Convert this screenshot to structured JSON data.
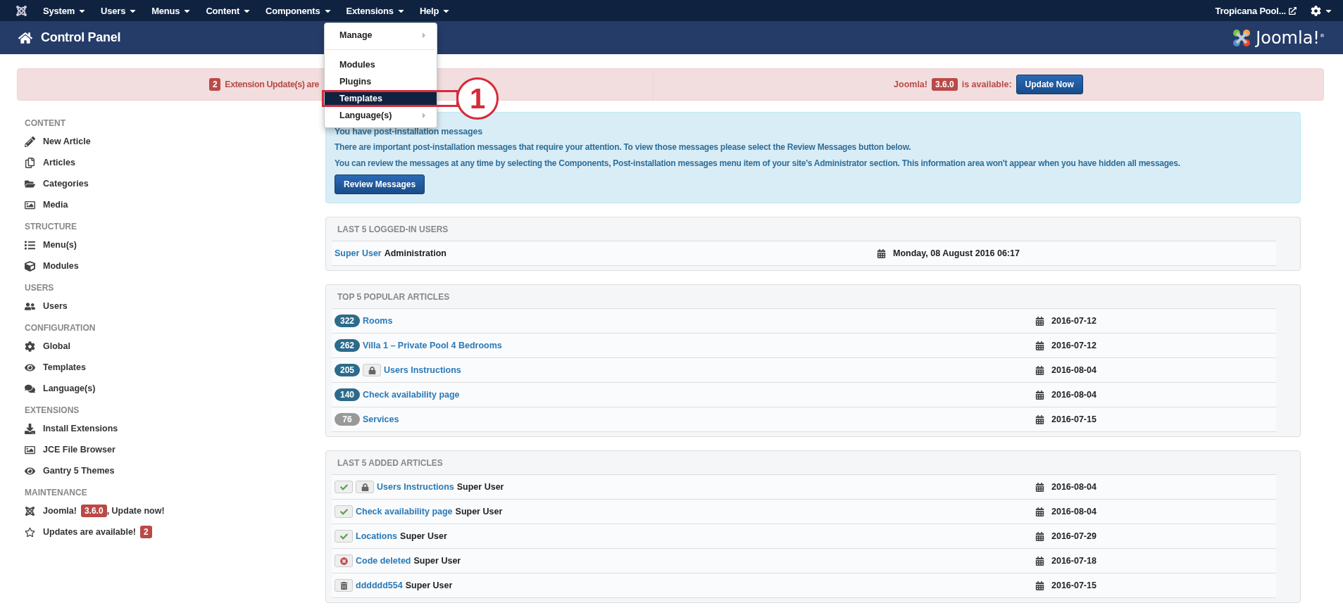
{
  "navbar": {
    "menus": [
      {
        "label": "System"
      },
      {
        "label": "Users"
      },
      {
        "label": "Menus"
      },
      {
        "label": "Content"
      },
      {
        "label": "Components"
      },
      {
        "label": "Extensions"
      },
      {
        "label": "Help"
      }
    ],
    "site_link": "Tropicana Pool..."
  },
  "header": {
    "title": "Control Panel",
    "logo_text": "Joomla!",
    "logo_mark": "®"
  },
  "dropdown": {
    "items": [
      {
        "kind": "submenu",
        "label": "Manage",
        "selected": false
      },
      {
        "kind": "divider"
      },
      {
        "kind": "item",
        "label": "Modules",
        "selected": false
      },
      {
        "kind": "item",
        "label": "Plugins",
        "selected": false
      },
      {
        "kind": "item",
        "label": "Templates",
        "selected": true
      },
      {
        "kind": "submenu",
        "label": "Language(s)",
        "selected": false
      }
    ]
  },
  "callout": {
    "number": "1"
  },
  "alerts": [
    {
      "badge": "2",
      "text": "Extension Update(s) are"
    },
    {
      "before": "Joomla!",
      "badge": "3.6.0",
      "after": "is available:",
      "button": "Update Now"
    }
  ],
  "sidebar": [
    {
      "heading": "CONTENT",
      "items": [
        {
          "label": "New Article"
        },
        {
          "label": "Articles"
        },
        {
          "label": "Categories"
        },
        {
          "label": "Media"
        }
      ]
    },
    {
      "heading": "STRUCTURE",
      "items": [
        {
          "label": "Menu(s)"
        },
        {
          "label": "Modules"
        }
      ]
    },
    {
      "heading": "USERS",
      "items": [
        {
          "label": "Users"
        }
      ]
    },
    {
      "heading": "CONFIGURATION",
      "items": [
        {
          "label": "Global"
        },
        {
          "label": "Templates"
        },
        {
          "label": "Language(s)"
        }
      ]
    },
    {
      "heading": "EXTENSIONS",
      "items": [
        {
          "label": "Install Extensions"
        },
        {
          "label": "JCE File Browser"
        },
        {
          "label": "Gantry 5 Themes"
        }
      ]
    },
    {
      "heading": "MAINTENANCE",
      "items": [
        {
          "label": "Joomla!",
          "badge": "3.6.0",
          "after": ", Update now!"
        },
        {
          "label": "Updates are available!",
          "badge": "2"
        }
      ]
    }
  ],
  "info": {
    "heading": "You have post-installation messages",
    "paragraphs": [
      "There are important post-installation messages that require your attention. To view those messages please select the Review Messages button below.",
      "You can review the messages at any time by selecting the Components, Post-installation messages menu item of your site's Administrator section. This information area won't appear when you have hidden all messages."
    ],
    "button": "Review Messages"
  },
  "logged_users": {
    "title": "LAST 5 LOGGED-IN USERS",
    "rows": [
      {
        "user": "Super User",
        "area": "Administration",
        "date": "Monday, 08 August 2016 06:17"
      }
    ]
  },
  "popular_articles": {
    "title": "TOP 5 POPULAR ARTICLES",
    "rows": [
      {
        "hits": "322",
        "hot": true,
        "locked": false,
        "title": "Rooms",
        "date": "2016-07-12"
      },
      {
        "hits": "262",
        "hot": true,
        "locked": false,
        "title": "Villa 1 – Private Pool 4 Bedrooms",
        "date": "2016-07-12"
      },
      {
        "hits": "205",
        "hot": true,
        "locked": true,
        "title": "Users Instructions",
        "date": "2016-08-04"
      },
      {
        "hits": "140",
        "hot": true,
        "locked": false,
        "title": "Check availability page",
        "date": "2016-08-04"
      },
      {
        "hits": "76",
        "hot": false,
        "locked": false,
        "title": "Services",
        "date": "2016-07-15"
      }
    ]
  },
  "added_articles": {
    "title": "LAST 5 ADDED ARTICLES",
    "rows": [
      {
        "kind": "published",
        "locked": true,
        "title": "Users Instructions",
        "author": "Super User",
        "date": "2016-08-04"
      },
      {
        "kind": "published",
        "locked": false,
        "title": "Check availability page",
        "author": "Super User",
        "date": "2016-08-04"
      },
      {
        "kind": "published",
        "locked": false,
        "title": "Locations",
        "author": "Super User",
        "date": "2016-07-29"
      },
      {
        "kind": "unpublished",
        "locked": false,
        "title": "Code deleted",
        "author": "Super User",
        "date": "2016-07-18"
      },
      {
        "kind": "trashed",
        "locked": false,
        "title": "dddddd554",
        "author": "Super User",
        "date": "2016-07-15"
      }
    ]
  }
}
